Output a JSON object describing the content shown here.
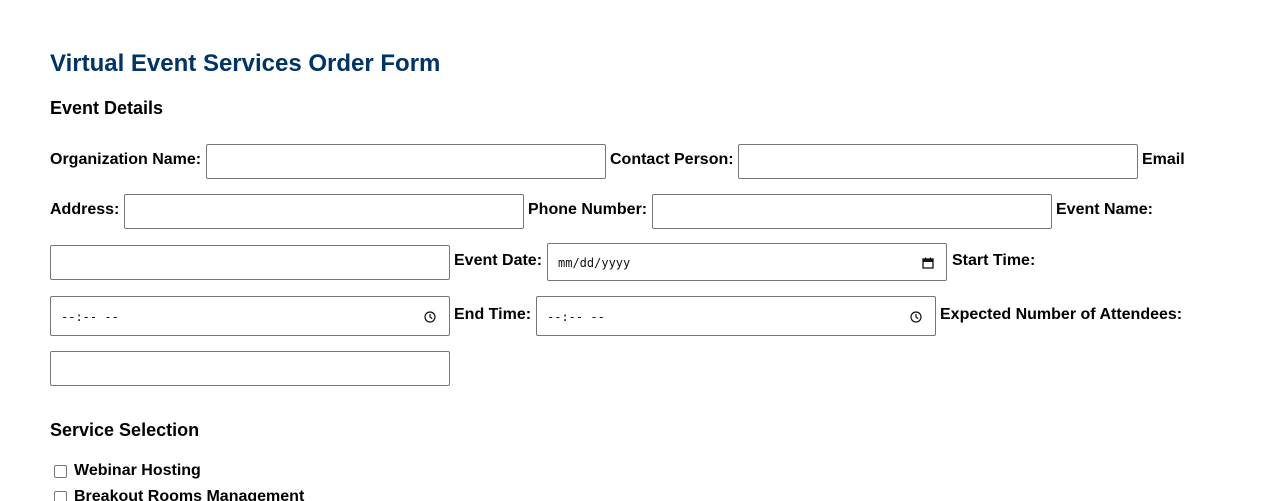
{
  "form": {
    "title": "Virtual Event Services Order Form"
  },
  "event_details": {
    "heading": "Event Details",
    "organization_name": {
      "label": "Organization Name:",
      "value": ""
    },
    "contact_person": {
      "label": "Contact Person:",
      "value": ""
    },
    "email_address": {
      "label_line1": "Email",
      "label_line2": "Address:",
      "value": ""
    },
    "phone_number": {
      "label": "Phone Number:",
      "value": ""
    },
    "event_name": {
      "label": "Event Name:",
      "value": ""
    },
    "event_date": {
      "label": "Event Date:",
      "display": "mm/dd/yyyy"
    },
    "start_time": {
      "label": "Start Time:",
      "display": "--:-- --"
    },
    "end_time": {
      "label": "End Time:",
      "display": "--:-- --"
    },
    "expected_attendees": {
      "label": "Expected Number of Attendees:",
      "value": ""
    }
  },
  "service_selection": {
    "heading": "Service Selection",
    "options": [
      {
        "label": "Webinar Hosting",
        "checked": false
      },
      {
        "label": "Breakout Rooms Management",
        "checked": false
      }
    ]
  },
  "icons": {
    "date_picker": "calendar-icon",
    "time_picker": "clock-icon"
  }
}
